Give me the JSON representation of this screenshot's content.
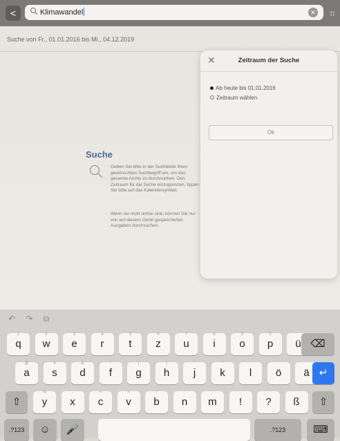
{
  "toolbar": {
    "back_glyph": "<",
    "search_value": "Klimawandel",
    "clear_glyph": "✕",
    "calendar_glyph": "⌗"
  },
  "main": {
    "date_range": "Suche von Fr., 01.01.2016 bis Mi., 04.12.2019",
    "suche_title": "Suche",
    "paragraph1": "Geben Sie bitte in der Suchleiste Ihren gewünschten Suchbegriff ein, um das gesamte Archiv zu durchsuchen. Den Zeitraum für die Suche einzugrenzen, tippen Sie bitte auf das Kalendersymbol.",
    "paragraph2": "Wenn sie nicht online sind, können Sie nur von auf diesem Gerät gespeicherten Ausgaben durchsuchen."
  },
  "popover": {
    "close_glyph": "✕",
    "title": "Zeitraum der Suche",
    "option1": "Ab heute bis 01.01.2016",
    "option2": "Zeitraum wählen",
    "ok_label": "Ok"
  },
  "keyboard": {
    "tools": "↶ ↷ ⧉",
    "row1": [
      "q",
      "w",
      "e",
      "r",
      "t",
      "z",
      "u",
      "i",
      "o",
      "p",
      "ü"
    ],
    "row1_hints": [
      "1",
      "2",
      "3",
      "4",
      "5",
      "6",
      "7",
      "8",
      "9",
      "0",
      ""
    ],
    "delete_glyph": "⌫",
    "row2": [
      "a",
      "s",
      "d",
      "f",
      "g",
      "h",
      "j",
      "k",
      "l",
      "ö",
      "ä"
    ],
    "row2_hints": [
      "@",
      "#",
      "&",
      "*",
      "(",
      ")",
      "'",
      "\"",
      "",
      "",
      ""
    ],
    "return_glyph": "↵",
    "shift_glyph": "⇧",
    "row3": [
      "y",
      "x",
      "c",
      "v",
      "b",
      "n",
      "m",
      "!",
      "?",
      "ß"
    ],
    "row3_hints": [
      "%",
      "-",
      "+",
      "=",
      "/",
      ";",
      ":",
      ",",
      ".",
      ""
    ],
    "row3_punct_hint": [
      ",",
      "."
    ],
    "numbers_label": ".?123",
    "emoji_glyph": "☺",
    "mic_glyph": "🎤",
    "space_label": "",
    "dismiss_glyph": "⌨",
    "colors": {
      "return_key": "#2f77ef",
      "key": "#f7f6f3",
      "dark_key": "#b3b1ad"
    }
  }
}
